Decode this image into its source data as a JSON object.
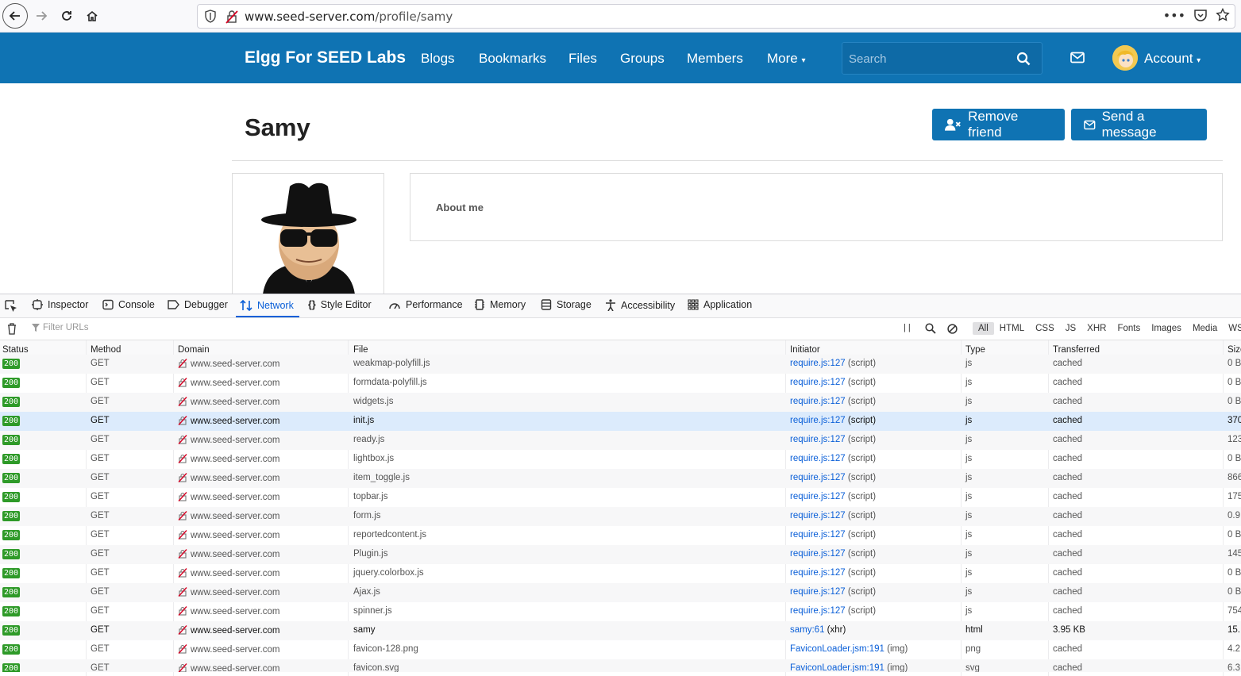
{
  "browser": {
    "url_host": "www.seed-server.com",
    "url_path": "/profile/samy"
  },
  "topbar": {
    "site_name": "Elgg For SEED Labs",
    "nav": [
      "Blogs",
      "Bookmarks",
      "Files",
      "Groups",
      "Members",
      "More"
    ],
    "search_placeholder": "Search",
    "account_label": "Account"
  },
  "profile": {
    "name": "Samy",
    "remove_friend": "Remove friend",
    "send_message": "Send a message",
    "about_label": "About me"
  },
  "devtools": {
    "tabs": [
      "Inspector",
      "Console",
      "Debugger",
      "Network",
      "Style Editor",
      "Performance",
      "Memory",
      "Storage",
      "Accessibility",
      "Application"
    ],
    "active_tab": "Network",
    "filter_placeholder": "Filter URLs",
    "type_filters": [
      "All",
      "HTML",
      "CSS",
      "JS",
      "XHR",
      "Fonts",
      "Images",
      "Media",
      "WS"
    ],
    "columns": [
      "Status",
      "Method",
      "Domain",
      "File",
      "Initiator",
      "Type",
      "Transferred",
      "Size"
    ],
    "requests": [
      {
        "status": "200",
        "method": "GET",
        "domain": "www.seed-server.com",
        "file": "weakmap-polyfill.js",
        "initiator": "require.js:127",
        "initiator_type": "(script)",
        "type": "js",
        "transferred": "cached",
        "size": "0 B"
      },
      {
        "status": "200",
        "method": "GET",
        "domain": "www.seed-server.com",
        "file": "formdata-polyfill.js",
        "initiator": "require.js:127",
        "initiator_type": "(script)",
        "type": "js",
        "transferred": "cached",
        "size": "0 B"
      },
      {
        "status": "200",
        "method": "GET",
        "domain": "www.seed-server.com",
        "file": "widgets.js",
        "initiator": "require.js:127",
        "initiator_type": "(script)",
        "type": "js",
        "transferred": "cached",
        "size": "0 B"
      },
      {
        "status": "200",
        "method": "GET",
        "domain": "www.seed-server.com",
        "file": "init.js",
        "initiator": "require.js:127",
        "initiator_type": "(script)",
        "type": "js",
        "transferred": "cached",
        "size": "370"
      },
      {
        "status": "200",
        "method": "GET",
        "domain": "www.seed-server.com",
        "file": "ready.js",
        "initiator": "require.js:127",
        "initiator_type": "(script)",
        "type": "js",
        "transferred": "cached",
        "size": "123"
      },
      {
        "status": "200",
        "method": "GET",
        "domain": "www.seed-server.com",
        "file": "lightbox.js",
        "initiator": "require.js:127",
        "initiator_type": "(script)",
        "type": "js",
        "transferred": "cached",
        "size": "0 B"
      },
      {
        "status": "200",
        "method": "GET",
        "domain": "www.seed-server.com",
        "file": "item_toggle.js",
        "initiator": "require.js:127",
        "initiator_type": "(script)",
        "type": "js",
        "transferred": "cached",
        "size": "866"
      },
      {
        "status": "200",
        "method": "GET",
        "domain": "www.seed-server.com",
        "file": "topbar.js",
        "initiator": "require.js:127",
        "initiator_type": "(script)",
        "type": "js",
        "transferred": "cached",
        "size": "175"
      },
      {
        "status": "200",
        "method": "GET",
        "domain": "www.seed-server.com",
        "file": "form.js",
        "initiator": "require.js:127",
        "initiator_type": "(script)",
        "type": "js",
        "transferred": "cached",
        "size": "0.9"
      },
      {
        "status": "200",
        "method": "GET",
        "domain": "www.seed-server.com",
        "file": "reportedcontent.js",
        "initiator": "require.js:127",
        "initiator_type": "(script)",
        "type": "js",
        "transferred": "cached",
        "size": "0 B"
      },
      {
        "status": "200",
        "method": "GET",
        "domain": "www.seed-server.com",
        "file": "Plugin.js",
        "initiator": "require.js:127",
        "initiator_type": "(script)",
        "type": "js",
        "transferred": "cached",
        "size": "145"
      },
      {
        "status": "200",
        "method": "GET",
        "domain": "www.seed-server.com",
        "file": "jquery.colorbox.js",
        "initiator": "require.js:127",
        "initiator_type": "(script)",
        "type": "js",
        "transferred": "cached",
        "size": "0 B"
      },
      {
        "status": "200",
        "method": "GET",
        "domain": "www.seed-server.com",
        "file": "Ajax.js",
        "initiator": "require.js:127",
        "initiator_type": "(script)",
        "type": "js",
        "transferred": "cached",
        "size": "0 B"
      },
      {
        "status": "200",
        "method": "GET",
        "domain": "www.seed-server.com",
        "file": "spinner.js",
        "initiator": "require.js:127",
        "initiator_type": "(script)",
        "type": "js",
        "transferred": "cached",
        "size": "754"
      },
      {
        "status": "200",
        "method": "GET",
        "domain": "www.seed-server.com",
        "file": "samy",
        "initiator": "samy:61",
        "initiator_type": "(xhr)",
        "type": "html",
        "transferred": "3.95 KB",
        "size": "15."
      },
      {
        "status": "200",
        "method": "GET",
        "domain": "www.seed-server.com",
        "file": "favicon-128.png",
        "initiator": "FaviconLoader.jsm:191",
        "initiator_type": "(img)",
        "type": "png",
        "transferred": "cached",
        "size": "4.2"
      },
      {
        "status": "200",
        "method": "GET",
        "domain": "www.seed-server.com",
        "file": "favicon.svg",
        "initiator": "FaviconLoader.jsm:191",
        "initiator_type": "(img)",
        "type": "svg",
        "transferred": "cached",
        "size": "6.3"
      }
    ]
  }
}
